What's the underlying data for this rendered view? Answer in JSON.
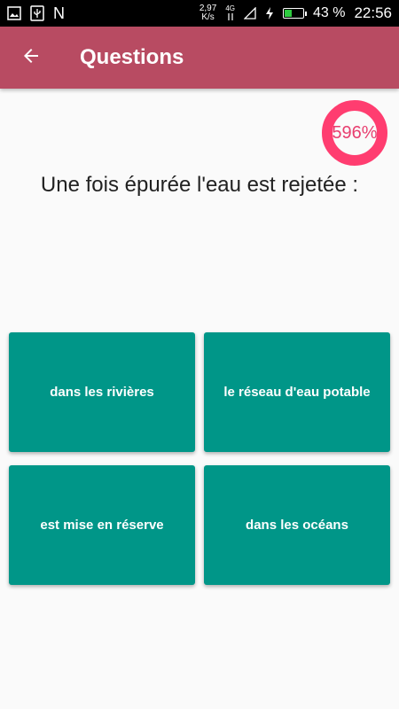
{
  "status_bar": {
    "net_speed_value": "2,97",
    "net_speed_unit": "K/s",
    "network_label": "4G",
    "carrier_letter": "N",
    "battery_percent": "43 %",
    "time": "22:56",
    "battery_level": 0.43
  },
  "app_bar": {
    "title": "Questions",
    "back_icon": "arrow-left-icon"
  },
  "progress": {
    "label": "596%",
    "ring_color": "#ff3d70"
  },
  "question": {
    "text": "Une fois épurée l'eau est rejetée :"
  },
  "answers": [
    {
      "label": "dans les rivières"
    },
    {
      "label": "le réseau d'eau potable"
    },
    {
      "label": "est mise en réserve"
    },
    {
      "label": "dans les océans"
    }
  ],
  "colors": {
    "app_bar": "#b84b62",
    "answer_button": "#009688",
    "progress_text": "#e83e6f"
  }
}
